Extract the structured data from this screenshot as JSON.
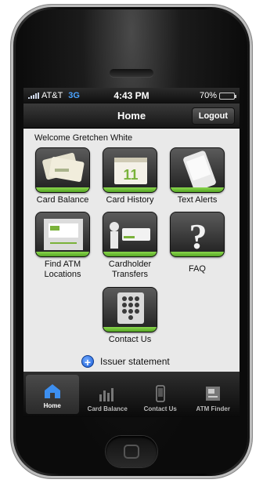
{
  "status_bar": {
    "carrier": "AT&T",
    "network": "3G",
    "time": "4:43 PM",
    "battery": "70%",
    "battery_level": 0.7
  },
  "nav": {
    "title": "Home",
    "logout_label": "Logout"
  },
  "welcome": "Welcome Gretchen  White",
  "tiles": [
    {
      "label_line1": "Card Balance",
      "label_line2": "",
      "icon": "cards-icon"
    },
    {
      "label_line1": "Card History",
      "label_line2": "",
      "icon": "calendar-icon"
    },
    {
      "label_line1": "Text Alerts",
      "label_line2": "",
      "icon": "phone-alert-icon"
    },
    {
      "label_line1": "Find ATM",
      "label_line2": "Locations",
      "icon": "atm-icon"
    },
    {
      "label_line1": "Cardholder",
      "label_line2": "Transfers",
      "icon": "transfer-icon"
    },
    {
      "label_line1": "FAQ",
      "label_line2": "",
      "icon": "question-icon"
    },
    {
      "label_line1": "Contact Us",
      "label_line2": "",
      "icon": "keypad-icon"
    }
  ],
  "issuer": {
    "label": "Issuer statement"
  },
  "tabbar": [
    {
      "label": "Home",
      "icon": "home-icon",
      "active": true
    },
    {
      "label": "Card Balance",
      "icon": "bar-chart-icon",
      "active": false
    },
    {
      "label": "Contact Us",
      "icon": "phone-icon",
      "active": false
    },
    {
      "label": "ATM Finder",
      "icon": "atm-machine-icon",
      "active": false
    }
  ],
  "colors": {
    "accent_green": "#6cc23a",
    "carrier_network": "#4aa3ff",
    "screen_bg": "#e9e9e9"
  }
}
